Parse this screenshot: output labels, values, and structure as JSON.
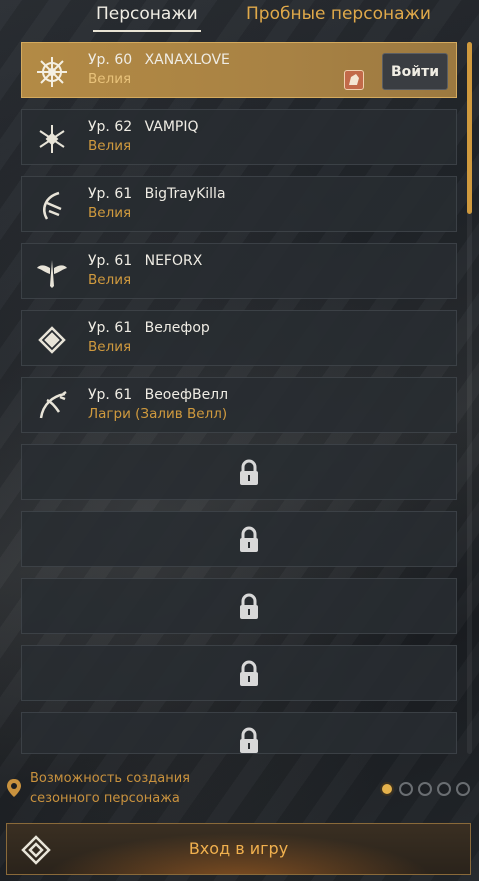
{
  "tabs": [
    {
      "label": "Персонажи",
      "active": true
    },
    {
      "label": "Пробные персонажи",
      "active": false
    }
  ],
  "characters": [
    {
      "level": "Ур. 60",
      "name": "XANAXLOVE",
      "server": "Велия",
      "selected": true,
      "icon": "dark-knight-icon"
    },
    {
      "level": "Ур. 62",
      "name": "VAMPIQ",
      "server": "Велия",
      "selected": false,
      "icon": "sorceress-icon"
    },
    {
      "level": "Ур. 61",
      "name": "BigTrayKilla",
      "server": "Велия",
      "selected": false,
      "icon": "witch-icon"
    },
    {
      "level": "Ур. 61",
      "name": "NEFORX",
      "server": "Велия",
      "selected": false,
      "icon": "valkyrie-icon"
    },
    {
      "level": "Ур. 61",
      "name": "Велефор",
      "server": "Велия",
      "selected": false,
      "icon": "mystic-icon"
    },
    {
      "level": "Ур. 61",
      "name": "ВеоефВелл",
      "server": "Лагри (Залив Велл)",
      "selected": false,
      "icon": "ranger-icon"
    }
  ],
  "selected_actions": {
    "enter_label": "Войти",
    "guild_badge_icon": "guild-emblem-icon"
  },
  "locked_slots": 5,
  "season": {
    "text": "Возможность создания сезонного персонажа",
    "icon": "season-marker-icon"
  },
  "pager": {
    "pages": 5,
    "current": 1
  },
  "enter_game": {
    "label": "Вход в игру",
    "icon": "rhombus-emblem-icon"
  },
  "colors": {
    "accent": "#d09a3e",
    "selected_bg": "#a88244",
    "server_text": "#d09a3e"
  }
}
